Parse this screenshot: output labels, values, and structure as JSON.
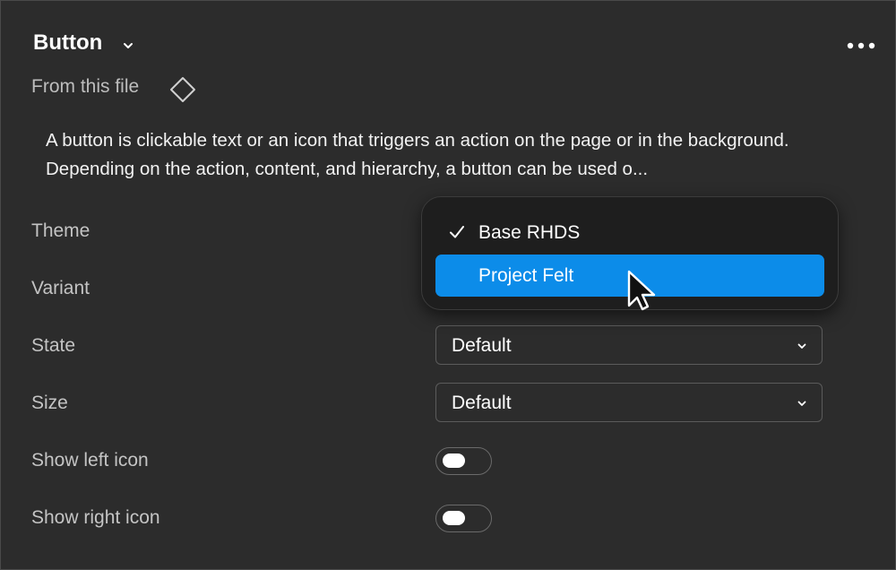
{
  "header": {
    "title": "Button"
  },
  "source": {
    "label": "From this file"
  },
  "description": "A button is clickable text or an icon that triggers an action on the page or in the background. Depending on the action, content, and hierarchy, a button can be used o...",
  "properties": {
    "theme": {
      "label": "Theme"
    },
    "variant": {
      "label": "Variant"
    },
    "state": {
      "label": "State",
      "value": "Default"
    },
    "size": {
      "label": "Size",
      "value": "Default"
    },
    "show_left_icon": {
      "label": "Show left icon",
      "on": false
    },
    "show_right_icon": {
      "label": "Show right icon",
      "on": false
    }
  },
  "theme_menu": {
    "options": [
      {
        "label": "Base RHDS",
        "checked": true
      },
      {
        "label": "Project Felt",
        "highlighted": true
      }
    ]
  },
  "colors": {
    "background": "#2c2c2c",
    "menu_background": "#1e1e1e",
    "highlight": "#0c8ce9"
  },
  "icons": [
    "chevron-down-icon",
    "more-options-icon",
    "component-icon",
    "check-icon",
    "cursor-icon"
  ]
}
